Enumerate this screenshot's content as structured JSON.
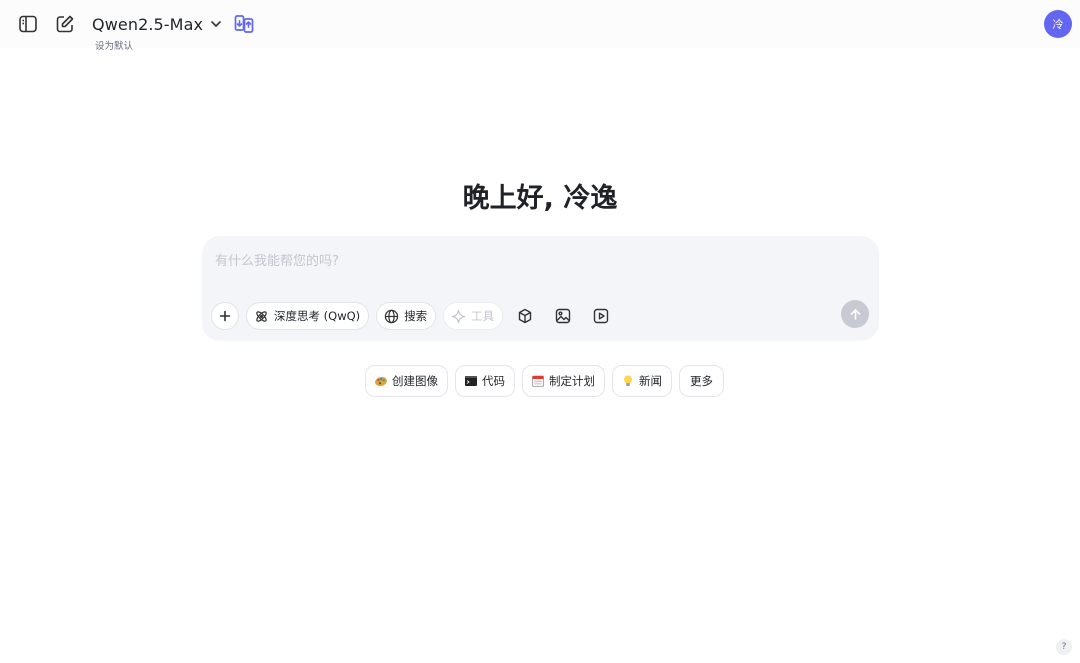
{
  "header": {
    "model_name": "Qwen2.5-Max",
    "set_default_label": "设为默认",
    "avatar_initial": "冷",
    "icons": [
      "sidebar-toggle-icon",
      "new-chat-icon",
      "chevron-down-icon",
      "compare-models-icon"
    ]
  },
  "main": {
    "greeting": "晚上好, 冷逸"
  },
  "composer": {
    "placeholder": "有什么我能帮您的吗?",
    "value": "",
    "tools": {
      "deep_think_label": "深度思考 (QwQ)",
      "search_label": "搜索",
      "tools_label": "工具"
    }
  },
  "suggestions": [
    {
      "label": "创建图像",
      "icon": "palette-emoji"
    },
    {
      "label": "代码",
      "icon": "terminal-emoji"
    },
    {
      "label": "制定计划",
      "icon": "calendar-emoji"
    },
    {
      "label": "新闻",
      "icon": "lightbulb-emoji"
    },
    {
      "label": "更多",
      "icon": ""
    }
  ],
  "footer": {
    "help_label": "?"
  },
  "colors": {
    "accent": "#6366f1",
    "send_disabled": "#c7c9d3",
    "composer_bg": "#f4f5f8"
  }
}
